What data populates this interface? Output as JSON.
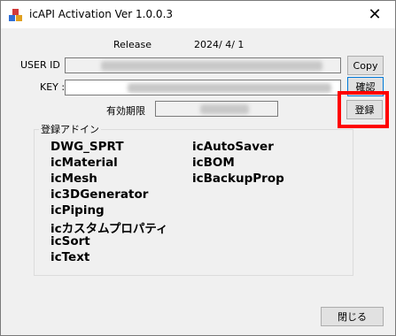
{
  "window": {
    "title": "icAPI Activation Ver 1.0.0.3",
    "close_glyph": "✕"
  },
  "release": {
    "label": "Release",
    "date": "2024/ 4/ 1"
  },
  "user_id": {
    "label": "USER ID",
    "value": "",
    "copy_label": "Copy"
  },
  "key": {
    "label": "KEY :",
    "value": "",
    "confirm_label": "確認"
  },
  "expiry": {
    "label": "有効期限",
    "value": "",
    "register_label": "登録"
  },
  "addins": {
    "legend": "登録アドイン",
    "col1": [
      "DWG_SPRT",
      "icMaterial",
      "icMesh",
      "ic3DGenerator",
      "icPiping",
      "icカスタムプロパティ",
      "icSort",
      "icText"
    ],
    "col2": [
      "icAutoSaver",
      "icBOM",
      "icBackupProp"
    ]
  },
  "footer": {
    "close_label": "閉じる"
  },
  "colors": {
    "highlight": "#ff0000",
    "focus": "#0078d7"
  },
  "icons": {
    "app": "app-blocks-icon",
    "close": "close-icon"
  }
}
